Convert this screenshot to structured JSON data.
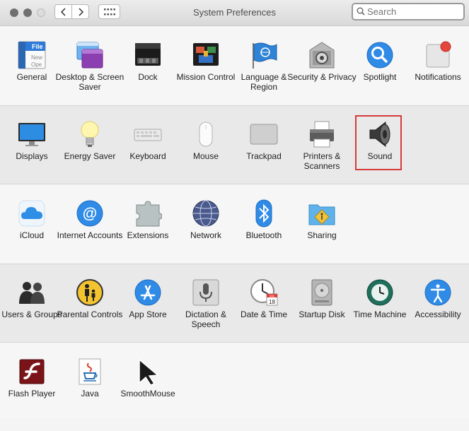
{
  "window": {
    "title": "System Preferences"
  },
  "search": {
    "placeholder": "Search",
    "value": ""
  },
  "rows": [
    {
      "items": [
        {
          "label": "General",
          "icon": "general-icon"
        },
        {
          "label": "Desktop & Screen Saver",
          "icon": "desktop-screensaver-icon"
        },
        {
          "label": "Dock",
          "icon": "dock-icon"
        },
        {
          "label": "Mission Control",
          "icon": "mission-control-icon"
        },
        {
          "label": "Language & Region",
          "icon": "language-region-icon"
        },
        {
          "label": "Security & Privacy",
          "icon": "security-privacy-icon"
        },
        {
          "label": "Spotlight",
          "icon": "spotlight-icon"
        },
        {
          "label": "Notifications",
          "icon": "notifications-icon"
        }
      ]
    },
    {
      "items": [
        {
          "label": "Displays",
          "icon": "displays-icon"
        },
        {
          "label": "Energy Saver",
          "icon": "energy-saver-icon"
        },
        {
          "label": "Keyboard",
          "icon": "keyboard-icon"
        },
        {
          "label": "Mouse",
          "icon": "mouse-icon"
        },
        {
          "label": "Trackpad",
          "icon": "trackpad-icon"
        },
        {
          "label": "Printers & Scanners",
          "icon": "printer-icon"
        },
        {
          "label": "Sound",
          "icon": "speaker-icon",
          "highlighted": true
        }
      ]
    },
    {
      "items": [
        {
          "label": "iCloud",
          "icon": "icloud-icon"
        },
        {
          "label": "Internet Accounts",
          "icon": "internet-accounts-icon"
        },
        {
          "label": "Extensions",
          "icon": "puzzle-piece-icon"
        },
        {
          "label": "Network",
          "icon": "network-globe-icon"
        },
        {
          "label": "Bluetooth",
          "icon": "bluetooth-icon"
        },
        {
          "label": "Sharing",
          "icon": "sharing-folder-icon"
        }
      ]
    },
    {
      "items": [
        {
          "label": "Users & Groups",
          "icon": "users-groups-icon"
        },
        {
          "label": "Parental Controls",
          "icon": "parental-controls-icon"
        },
        {
          "label": "App Store",
          "icon": "app-store-icon"
        },
        {
          "label": "Dictation & Speech",
          "icon": "microphone-icon"
        },
        {
          "label": "Date & Time",
          "icon": "clock-calendar-icon"
        },
        {
          "label": "Startup Disk",
          "icon": "hard-disk-icon"
        },
        {
          "label": "Time Machine",
          "icon": "time-machine-icon"
        },
        {
          "label": "Accessibility",
          "icon": "accessibility-icon"
        }
      ]
    },
    {
      "items": [
        {
          "label": "Flash Player",
          "icon": "flash-player-icon"
        },
        {
          "label": "Java",
          "icon": "java-icon"
        },
        {
          "label": "SmoothMouse",
          "icon": "cursor-arrow-icon"
        }
      ]
    }
  ],
  "icon_text": {
    "general": "File",
    "general_lines": [
      "New",
      "Ope"
    ],
    "calendar_month": "JUL",
    "calendar_day": "18"
  },
  "colors": {
    "highlight": "#d63a3a",
    "accent": "#1a73d9"
  }
}
